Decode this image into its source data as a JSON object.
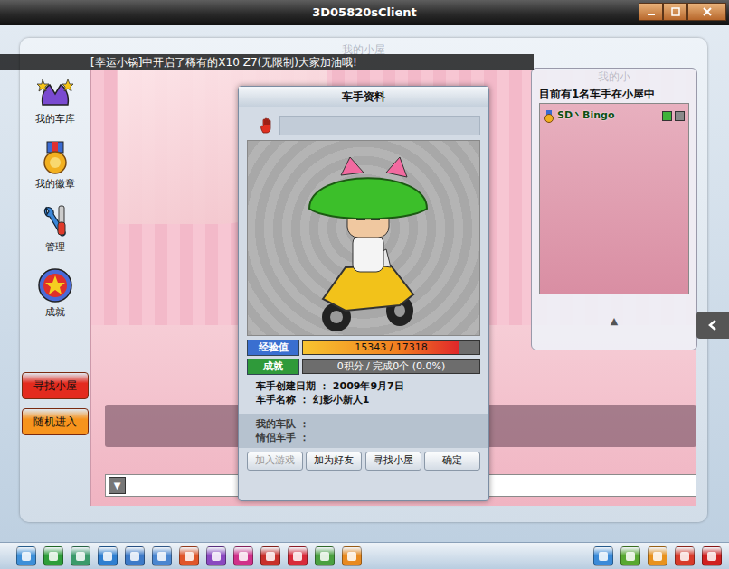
{
  "window": {
    "title": "3D05820sClient"
  },
  "room": {
    "title": "我的小屋"
  },
  "announcement": "[幸运小锅]中开启了稀有的X10 Z7(无限制)大家加油哦!",
  "sidebar": {
    "items": [
      {
        "label": "我的车库"
      },
      {
        "label": "我的徽章"
      },
      {
        "label": "管理"
      },
      {
        "label": "成就"
      }
    ],
    "buttons": [
      {
        "label": "寻找小屋",
        "color": "#e32b1e"
      },
      {
        "label": "随机进入",
        "color": "#f7941d"
      }
    ]
  },
  "profile": {
    "title": "车手资料",
    "exp": {
      "label": "经验值",
      "reading": "15343 / 17318",
      "level": 0.886,
      "color": "#3a6fd0"
    },
    "achievement": {
      "label": "成就",
      "reading": "0积分 / 完成0个 (0.0%)",
      "level": 0,
      "color": "#2f9a3a"
    },
    "fields": [
      {
        "label": "车手创建日期 ：",
        "value": "2009年9月7日"
      },
      {
        "label": "车手名称 ：",
        "value": "幻影小新人1"
      }
    ],
    "team": [
      {
        "label": "我的车队 ："
      },
      {
        "label": "情侣车手 ："
      }
    ],
    "buttons": [
      {
        "label": "加入游戏",
        "disabled": true
      },
      {
        "label": "加为好友",
        "disabled": false
      },
      {
        "label": "寻找小屋",
        "disabled": false
      },
      {
        "label": "确定",
        "disabled": false
      }
    ]
  },
  "room_list": {
    "title": "我的小",
    "header": "目前有1名车手在小屋中",
    "players": [
      {
        "name": "SD丶Bingo"
      }
    ],
    "scroll": "▲"
  },
  "chat": {
    "toggle": "▼"
  },
  "taskbar": {
    "left": [
      {
        "color": "#3d8fd8"
      },
      {
        "color": "#2e9e3a"
      },
      {
        "color": "#3b9a6a"
      },
      {
        "color": "#2f7fd0"
      },
      {
        "color": "#3d7ac8"
      },
      {
        "color": "#4a86d0"
      },
      {
        "color": "#e0562a"
      },
      {
        "color": "#8a48c0"
      },
      {
        "color": "#d0308a"
      },
      {
        "color": "#c8302a"
      },
      {
        "color": "#d82a3a"
      },
      {
        "color": "#4aa040"
      },
      {
        "color": "#e88a20"
      }
    ],
    "right": [
      {
        "color": "#3a8ad8"
      },
      {
        "color": "#58a830"
      },
      {
        "color": "#e8921e"
      },
      {
        "color": "#d83a2a"
      },
      {
        "color": "#d02020"
      }
    ]
  }
}
